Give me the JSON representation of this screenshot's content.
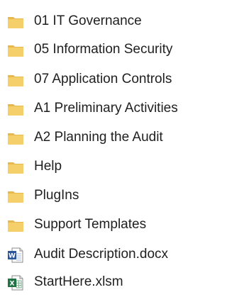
{
  "items": [
    {
      "label": "01 IT Governance",
      "icon": "folder-icon"
    },
    {
      "label": "05 Information Security",
      "icon": "folder-icon"
    },
    {
      "label": "07 Application Controls",
      "icon": "folder-icon"
    },
    {
      "label": "A1 Preliminary Activities",
      "icon": "folder-icon"
    },
    {
      "label": "A2 Planning the Audit",
      "icon": "folder-icon"
    },
    {
      "label": "Help",
      "icon": "folder-icon"
    },
    {
      "label": "PlugIns",
      "icon": "folder-icon"
    },
    {
      "label": "Support Templates",
      "icon": "folder-icon"
    },
    {
      "label": "Audit Description.docx",
      "icon": "word-document-icon"
    },
    {
      "label": "StartHere.xlsm",
      "icon": "excel-macro-workbook-icon"
    }
  ],
  "colors": {
    "folder_back": "#E5B94E",
    "folder_front": "#F4CF6A",
    "word_blue": "#2B579A",
    "excel_green": "#217346"
  }
}
